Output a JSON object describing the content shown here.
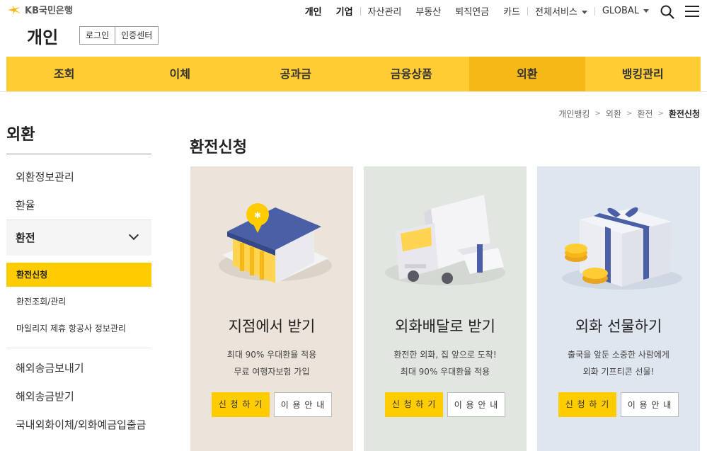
{
  "brand": {
    "logo_text": "KB국민은행",
    "site_title": "개인"
  },
  "login": {
    "login_label": "로그인",
    "cert_label": "인증센터"
  },
  "gnb": {
    "items": [
      "개인",
      "기업",
      "자산관리",
      "부동산",
      "퇴직연금",
      "카드",
      "전체서비스",
      "GLOBAL"
    ]
  },
  "mainnav": {
    "items": [
      "조회",
      "이체",
      "공과금",
      "금융상품",
      "외환",
      "뱅킹관리"
    ],
    "active": "외환"
  },
  "breadcrumb": [
    "개인뱅킹",
    "외환",
    "환전",
    "환전신청"
  ],
  "lnb": {
    "title": "외환",
    "items_top": [
      "외환정보관리",
      "환율"
    ],
    "group_title": "환전",
    "group_items": [
      "환전신청",
      "환전조회/관리",
      "마일리지 제휴 항공사 정보관리"
    ],
    "items_bottom": [
      "해외송금보내기",
      "해외송금받기",
      "국내외화이체/외화예금입출금"
    ]
  },
  "page_title": "환전신청",
  "cards": [
    {
      "title": "지점에서 받기",
      "desc1": "최대 90% 우대환율 적용",
      "desc2": "무료 여행자보험 가입",
      "apply": "신 청 하 기",
      "guide": "이 용 안 내",
      "bg": "#ece4da"
    },
    {
      "title": "외화배달로 받기",
      "desc1": "환전한 외화, 집 앞으로 도착!",
      "desc2": "최대 90% 우대환율 적용",
      "apply": "신 청 하 기",
      "guide": "이 용 안 내",
      "bg": "#e2e6e1"
    },
    {
      "title": "외화 선물하기",
      "desc1": "출국을 앞둔 소중한 사람에게",
      "desc2": "외화 기프티콘 선물!",
      "apply": "신 청 하 기",
      "guide": "이 용 안 내",
      "bg": "#dfe6f0"
    }
  ],
  "colors": {
    "accent": "#ffcc33",
    "accent_active": "#f6b816",
    "button": "#ffcc00"
  }
}
